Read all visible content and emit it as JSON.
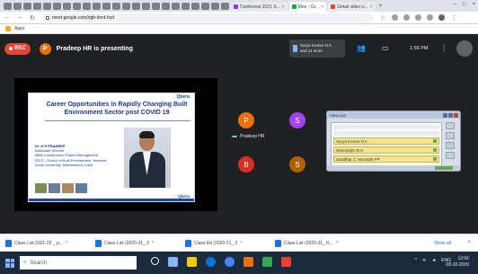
{
  "browser": {
    "tabs": [
      {
        "label": "",
        "color": "#1a73e8"
      },
      {
        "label": "Conformat 2021 S...",
        "color": "#9334e6"
      },
      {
        "label": "Mee - Gr...",
        "color": "#00ac47",
        "active": true
      },
      {
        "label": "Gmail video s...",
        "color": "#ea4335"
      }
    ],
    "window_controls": {
      "minimize": "–",
      "maximize": "□",
      "close": "×"
    },
    "address": "meet.google.com/ogb-dvnt-hcd",
    "bookmark_label": "Apps"
  },
  "meet": {
    "rec_label": "REC",
    "presenter_initial": "P",
    "presenting_text": "Pradeep HR is presenting",
    "participants_chip": {
      "line1": "Surya Kumar N A",
      "line2": "and 11 more"
    },
    "clock": "1:56 PM"
  },
  "slide": {
    "logo_top": "Qbera",
    "title": "Career Opportunities in Rapidly Changing Built Environment Sector post COVID 19",
    "speaker_name": "Dr. H P PRADEEP",
    "speaker_lines": [
      "Associate Director",
      "MBA Construction Project Management",
      "RICS - School of Built Environment, Mumbai",
      "Amity University, Maharashtra, India"
    ],
    "logo_bottom": "Qbera"
  },
  "tiles": [
    {
      "initial": "P",
      "color": "#e8710a",
      "label": "Pradeep HR"
    },
    {
      "initial": "S",
      "color": "#a142f4"
    },
    {
      "initial": "B",
      "color": "#d93025"
    },
    {
      "initial": "S",
      "color": "#b06000"
    }
  ],
  "chat": {
    "title": "View List",
    "rows": [
      "Surya Kumar N A",
      "Sreeranjini R K",
      "Sasidhar C Varunath PP"
    ]
  },
  "downloads": {
    "items": [
      "Class List 2021-22 _ p...",
      "Class List (2020-21_ 2",
      "Class list (2020-21_ 2",
      "Class List (2020-21_ K..."
    ],
    "show_all": "Show all"
  },
  "taskbar": {
    "search_placeholder": "Search",
    "tray_lang": "ENG",
    "time": "13:56",
    "date": "08-10-2020",
    "icon_colors": [
      "#ffffff",
      "#2b88d8",
      "#f2c811",
      "#0078d4",
      "#4285f4",
      "#e8710a",
      "#34a853",
      "#ea4335"
    ]
  }
}
